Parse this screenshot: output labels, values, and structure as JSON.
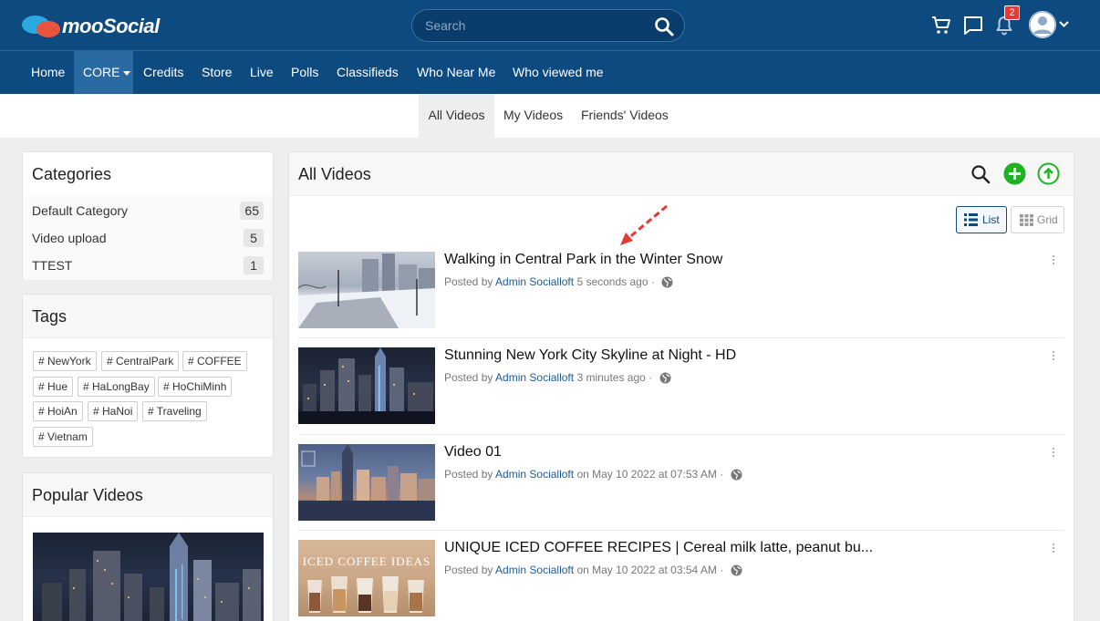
{
  "header": {
    "logo_text": "mooSocial",
    "search_placeholder": "Search",
    "notification_count": "2"
  },
  "nav": {
    "items": [
      {
        "label": "Home"
      },
      {
        "label": "CORE"
      },
      {
        "label": "Credits"
      },
      {
        "label": "Store"
      },
      {
        "label": "Live"
      },
      {
        "label": "Polls"
      },
      {
        "label": "Classifieds"
      },
      {
        "label": "Who Near Me"
      },
      {
        "label": "Who viewed me"
      }
    ]
  },
  "subtabs": [
    {
      "label": "All Videos"
    },
    {
      "label": "My Videos"
    },
    {
      "label": "Friends' Videos"
    }
  ],
  "categories": {
    "title": "Categories",
    "items": [
      {
        "label": "Default Category",
        "count": "65"
      },
      {
        "label": "Video upload",
        "count": "5"
      },
      {
        "label": "TTEST",
        "count": "1"
      }
    ]
  },
  "tags": {
    "title": "Tags",
    "items": [
      "# NewYork",
      "# CentralPark",
      "# COFFEE",
      "# Hue",
      "# HaLongBay",
      "# HoChiMinh",
      "# HoiAn",
      "# HaNoi",
      "# Traveling",
      "# Vietnam"
    ]
  },
  "popular": {
    "title": "Popular Videos"
  },
  "main": {
    "title": "All Videos",
    "view_list_label": "List",
    "view_grid_label": "Grid",
    "videos": [
      {
        "title": "Walking in Central Park in the Winter Snow",
        "posted_by": "Posted by",
        "author": "Admin Socialloft",
        "time": "5 seconds ago",
        "sep": "·"
      },
      {
        "title": "Stunning New York City Skyline at Night - HD",
        "posted_by": "Posted by",
        "author": "Admin Socialloft",
        "time": "3 minutes ago",
        "sep": "·"
      },
      {
        "title": "Video 01",
        "posted_by": "Posted by",
        "author": "Admin Socialloft",
        "time": "on May 10 2022 at 07:53 AM",
        "sep": "·"
      },
      {
        "title": "UNIQUE ICED COFFEE RECIPES | Cereal milk latte, peanut bu...",
        "posted_by": "Posted by",
        "author": "Admin Socialloft",
        "time": "on May 10 2022 at 03:54 AM",
        "sep": "·",
        "thumb_text": "ICED COFFEE IDEAS"
      }
    ]
  },
  "colors": {
    "header_bg": "#0c4a80",
    "nav_active": "#2a6aa3",
    "add_green": "#1db323",
    "link_blue": "#1c5b94",
    "annotation_red": "#e53935"
  }
}
